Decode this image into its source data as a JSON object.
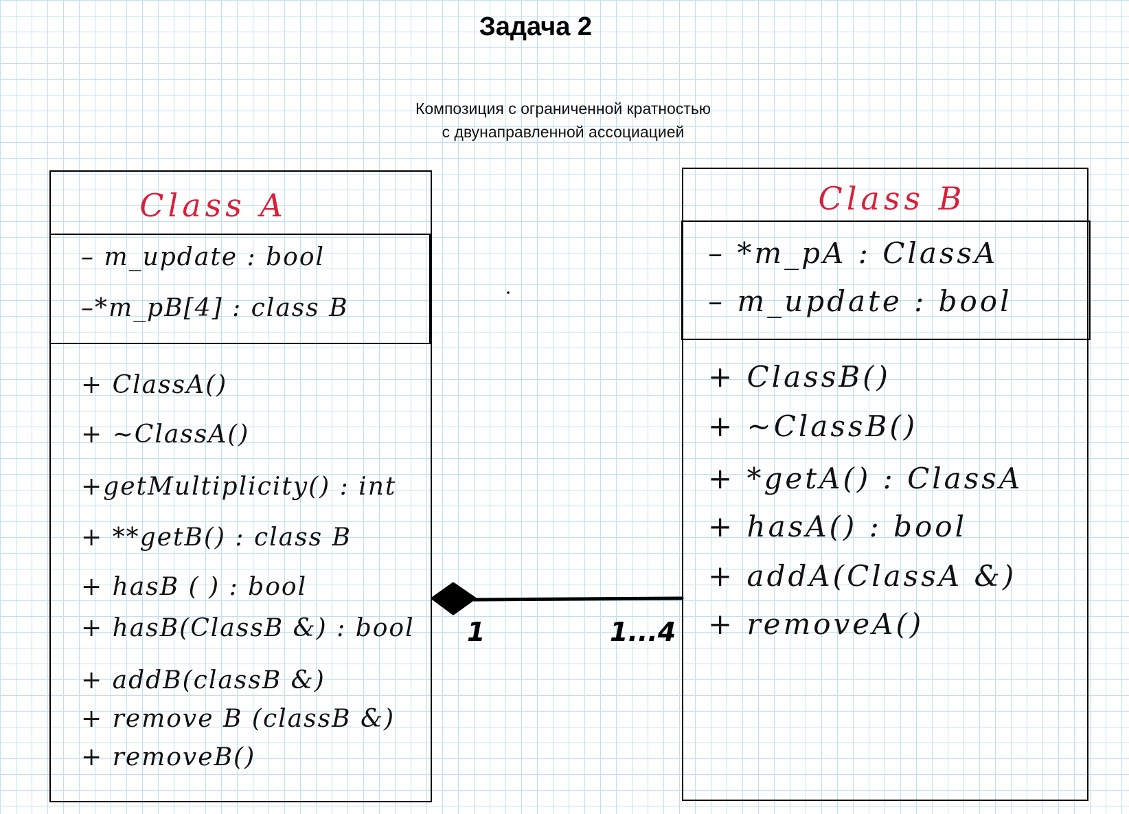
{
  "title": "Задача 2",
  "subtitle": {
    "line1": "Композиция с ограниченной кратностью",
    "line2": "с двунаправленной ассоциацией"
  },
  "class_a": {
    "name": "Class A",
    "attributes": [
      "– m_update : bool",
      "–*m_pB[4] : class B"
    ],
    "methods": [
      "+ ClassA()",
      "+ ~ClassA()",
      "+getMultiplicity() : int",
      "+ **getB() : class B",
      "+ hasB ( ) : bool",
      "+ hasB(ClassB &) : bool",
      "+ addB(classB &)",
      "+ remove B (classB &)",
      "+ removeB()"
    ]
  },
  "class_b": {
    "name": "Class B",
    "attributes": [
      "– *m_pA : ClassA",
      "– m_update : bool"
    ],
    "methods": [
      "+ ClassB()",
      "+ ~ClassB()",
      "+ *getA() : ClassA",
      "+ hasA() : bool",
      "+ addA(ClassA &)",
      "+ removeA()"
    ]
  },
  "association": {
    "type": "composition",
    "end_a_multiplicity": "1",
    "end_b_multiplicity": "1...4"
  }
}
